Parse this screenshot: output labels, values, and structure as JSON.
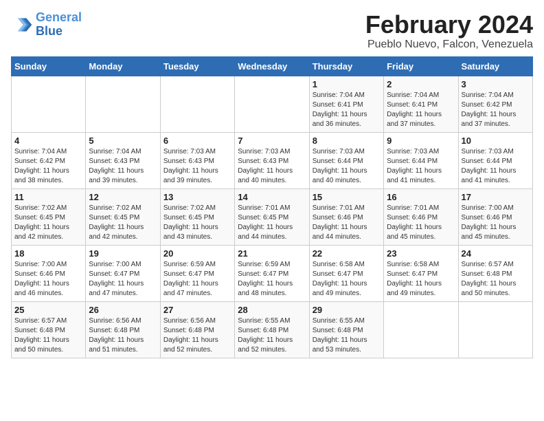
{
  "header": {
    "logo_line1": "General",
    "logo_line2": "Blue",
    "month": "February 2024",
    "location": "Pueblo Nuevo, Falcon, Venezuela"
  },
  "weekdays": [
    "Sunday",
    "Monday",
    "Tuesday",
    "Wednesday",
    "Thursday",
    "Friday",
    "Saturday"
  ],
  "weeks": [
    [
      {
        "day": "",
        "info": ""
      },
      {
        "day": "",
        "info": ""
      },
      {
        "day": "",
        "info": ""
      },
      {
        "day": "",
        "info": ""
      },
      {
        "day": "1",
        "info": "Sunrise: 7:04 AM\nSunset: 6:41 PM\nDaylight: 11 hours\nand 36 minutes."
      },
      {
        "day": "2",
        "info": "Sunrise: 7:04 AM\nSunset: 6:41 PM\nDaylight: 11 hours\nand 37 minutes."
      },
      {
        "day": "3",
        "info": "Sunrise: 7:04 AM\nSunset: 6:42 PM\nDaylight: 11 hours\nand 37 minutes."
      }
    ],
    [
      {
        "day": "4",
        "info": "Sunrise: 7:04 AM\nSunset: 6:42 PM\nDaylight: 11 hours\nand 38 minutes."
      },
      {
        "day": "5",
        "info": "Sunrise: 7:04 AM\nSunset: 6:43 PM\nDaylight: 11 hours\nand 39 minutes."
      },
      {
        "day": "6",
        "info": "Sunrise: 7:03 AM\nSunset: 6:43 PM\nDaylight: 11 hours\nand 39 minutes."
      },
      {
        "day": "7",
        "info": "Sunrise: 7:03 AM\nSunset: 6:43 PM\nDaylight: 11 hours\nand 40 minutes."
      },
      {
        "day": "8",
        "info": "Sunrise: 7:03 AM\nSunset: 6:44 PM\nDaylight: 11 hours\nand 40 minutes."
      },
      {
        "day": "9",
        "info": "Sunrise: 7:03 AM\nSunset: 6:44 PM\nDaylight: 11 hours\nand 41 minutes."
      },
      {
        "day": "10",
        "info": "Sunrise: 7:03 AM\nSunset: 6:44 PM\nDaylight: 11 hours\nand 41 minutes."
      }
    ],
    [
      {
        "day": "11",
        "info": "Sunrise: 7:02 AM\nSunset: 6:45 PM\nDaylight: 11 hours\nand 42 minutes."
      },
      {
        "day": "12",
        "info": "Sunrise: 7:02 AM\nSunset: 6:45 PM\nDaylight: 11 hours\nand 42 minutes."
      },
      {
        "day": "13",
        "info": "Sunrise: 7:02 AM\nSunset: 6:45 PM\nDaylight: 11 hours\nand 43 minutes."
      },
      {
        "day": "14",
        "info": "Sunrise: 7:01 AM\nSunset: 6:45 PM\nDaylight: 11 hours\nand 44 minutes."
      },
      {
        "day": "15",
        "info": "Sunrise: 7:01 AM\nSunset: 6:46 PM\nDaylight: 11 hours\nand 44 minutes."
      },
      {
        "day": "16",
        "info": "Sunrise: 7:01 AM\nSunset: 6:46 PM\nDaylight: 11 hours\nand 45 minutes."
      },
      {
        "day": "17",
        "info": "Sunrise: 7:00 AM\nSunset: 6:46 PM\nDaylight: 11 hours\nand 45 minutes."
      }
    ],
    [
      {
        "day": "18",
        "info": "Sunrise: 7:00 AM\nSunset: 6:46 PM\nDaylight: 11 hours\nand 46 minutes."
      },
      {
        "day": "19",
        "info": "Sunrise: 7:00 AM\nSunset: 6:47 PM\nDaylight: 11 hours\nand 47 minutes."
      },
      {
        "day": "20",
        "info": "Sunrise: 6:59 AM\nSunset: 6:47 PM\nDaylight: 11 hours\nand 47 minutes."
      },
      {
        "day": "21",
        "info": "Sunrise: 6:59 AM\nSunset: 6:47 PM\nDaylight: 11 hours\nand 48 minutes."
      },
      {
        "day": "22",
        "info": "Sunrise: 6:58 AM\nSunset: 6:47 PM\nDaylight: 11 hours\nand 49 minutes."
      },
      {
        "day": "23",
        "info": "Sunrise: 6:58 AM\nSunset: 6:47 PM\nDaylight: 11 hours\nand 49 minutes."
      },
      {
        "day": "24",
        "info": "Sunrise: 6:57 AM\nSunset: 6:48 PM\nDaylight: 11 hours\nand 50 minutes."
      }
    ],
    [
      {
        "day": "25",
        "info": "Sunrise: 6:57 AM\nSunset: 6:48 PM\nDaylight: 11 hours\nand 50 minutes."
      },
      {
        "day": "26",
        "info": "Sunrise: 6:56 AM\nSunset: 6:48 PM\nDaylight: 11 hours\nand 51 minutes."
      },
      {
        "day": "27",
        "info": "Sunrise: 6:56 AM\nSunset: 6:48 PM\nDaylight: 11 hours\nand 52 minutes."
      },
      {
        "day": "28",
        "info": "Sunrise: 6:55 AM\nSunset: 6:48 PM\nDaylight: 11 hours\nand 52 minutes."
      },
      {
        "day": "29",
        "info": "Sunrise: 6:55 AM\nSunset: 6:48 PM\nDaylight: 11 hours\nand 53 minutes."
      },
      {
        "day": "",
        "info": ""
      },
      {
        "day": "",
        "info": ""
      }
    ]
  ]
}
